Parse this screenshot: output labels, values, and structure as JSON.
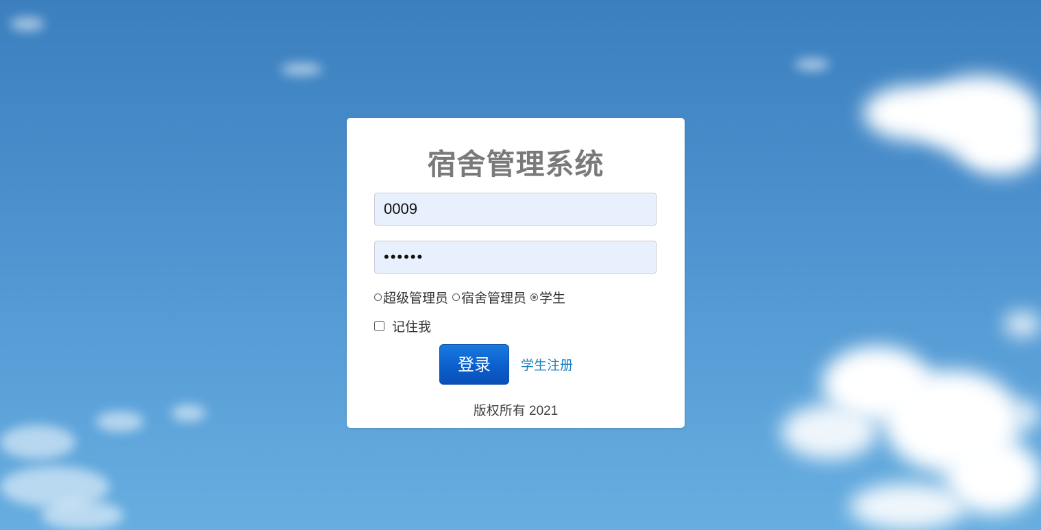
{
  "page": {
    "title": "宿舍管理系统"
  },
  "login": {
    "username_value": "0009",
    "password_value": "••••••",
    "roles": [
      {
        "label": "超级管理员",
        "checked": false
      },
      {
        "label": "宿舍管理员",
        "checked": false
      },
      {
        "label": "学生",
        "checked": true
      }
    ],
    "remember_label": "记住我",
    "login_button_label": "登录",
    "register_link_label": "学生注册",
    "copyright": "版权所有 2021"
  },
  "colors": {
    "sky": "#4a8fcc",
    "button": "#0b5fcc",
    "link": "#1a7fc1",
    "title": "#7a7a7a",
    "input_bg": "#e8f0fe"
  }
}
